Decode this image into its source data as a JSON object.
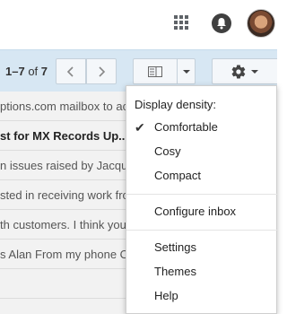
{
  "pagination": {
    "range": "1–7",
    "of_label": "of",
    "total": "7"
  },
  "icons": {
    "apps": "apps-grid-icon",
    "notifications": "notifications-icon",
    "prev": "chevron-left-icon",
    "next": "chevron-right-icon",
    "split_view": "split-pane-icon",
    "settings": "gear-icon"
  },
  "emails": [
    {
      "snippet": "ptions.com mailbox to ac",
      "bold": false
    },
    {
      "snippet": "st for MX Records Up...",
      "bold": true
    },
    {
      "snippet": "n issues raised by Jacqui",
      "bold": false
    },
    {
      "snippet": "sted in receiving work fro",
      "bold": false
    },
    {
      "snippet": "th customers. I think you",
      "bold": false
    },
    {
      "snippet": "s Alan From my phone O",
      "bold": false
    },
    {
      "snippet": "",
      "bold": false
    }
  ],
  "settings_menu": {
    "density_header": "Display density:",
    "density_options": [
      {
        "label": "Comfortable",
        "selected": true
      },
      {
        "label": "Cosy",
        "selected": false
      },
      {
        "label": "Compact",
        "selected": false
      }
    ],
    "configure_inbox": "Configure inbox",
    "settings": "Settings",
    "themes": "Themes",
    "help": "Help"
  },
  "colors": {
    "toolbar_bg": "#d7e7f3",
    "list_bg": "#f2f2f2",
    "menu_bg": "#ffffff"
  }
}
